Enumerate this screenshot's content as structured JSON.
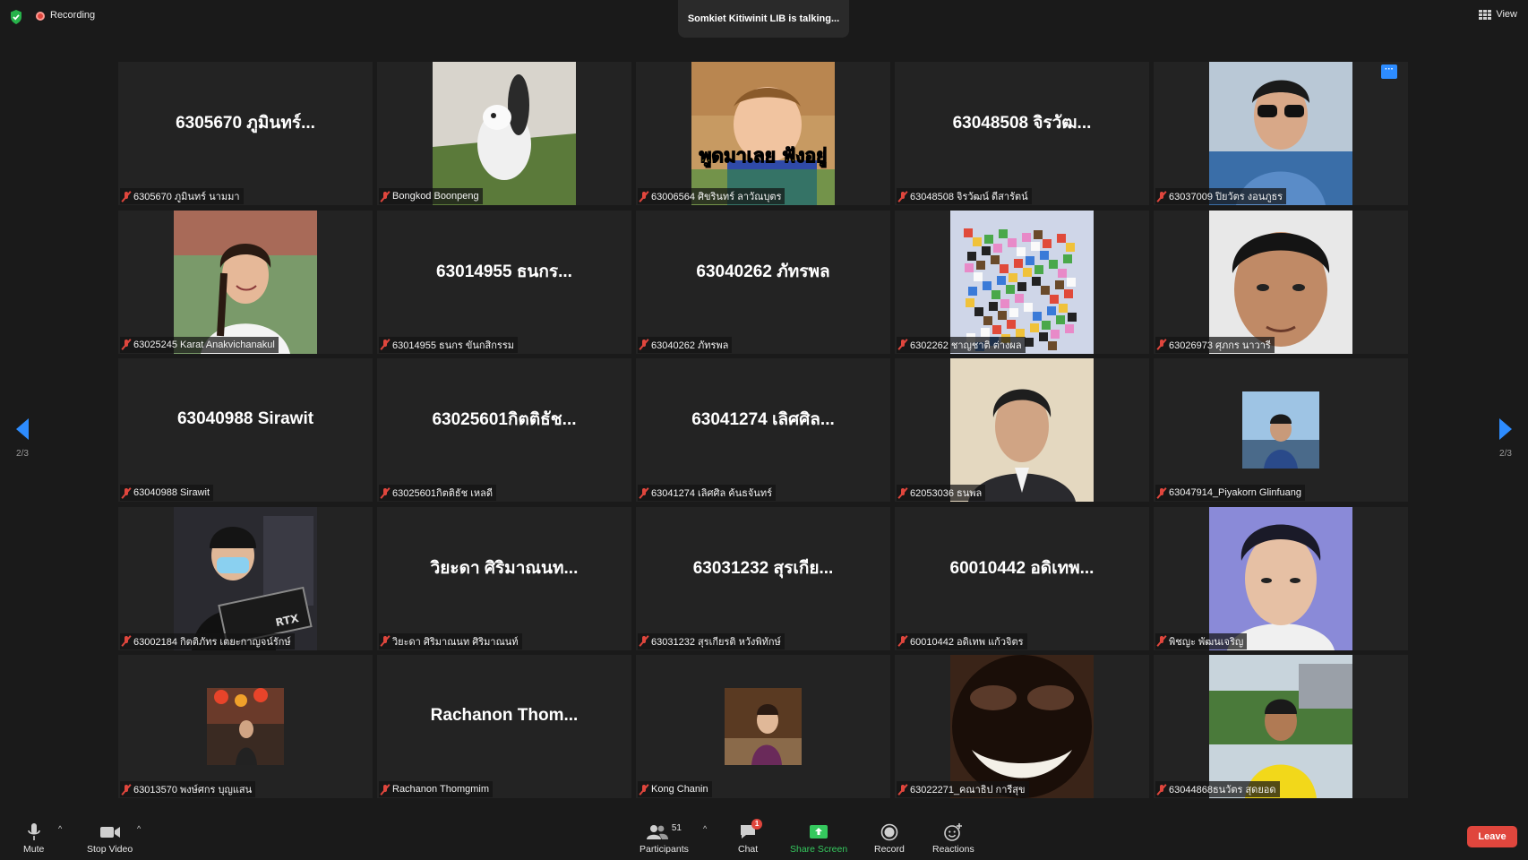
{
  "top_bar": {
    "recording_label": "Recording",
    "talking_text": "Somkiet Kitiwinit LIB is talking...",
    "view_label": "View"
  },
  "pagination": {
    "left": "2/3",
    "right": "2/3"
  },
  "tiles": [
    {
      "big": "6305670 ภูมินทร์...",
      "label": "6305670 ภูมินทร์ นามมา",
      "art": "none"
    },
    {
      "big": "",
      "label": "Bongkod Boonpeng",
      "art": "dog"
    },
    {
      "big": "",
      "label": "63006564 ศิขรินทร์ ลาวัณบุตร",
      "art": "baby"
    },
    {
      "big": "63048508 จิรวัฒ...",
      "label": "63048508 จิรวัฒน์ ดีสารัตน์",
      "art": "none"
    },
    {
      "big": "",
      "label": "63037009 ปิยวัตร งอนภูธร",
      "art": "man-sunglasses",
      "more": "···"
    },
    {
      "big": "",
      "label": "63025245 Karat Anakvichanakul",
      "art": "girl"
    },
    {
      "big": "63014955 ธนกร...",
      "label": "63014955 ธนกร ขันกสิกรรม",
      "art": "none"
    },
    {
      "big": "63040262 ภัทรพล",
      "label": "63040262 ภัทรพล",
      "art": "none"
    },
    {
      "big": "",
      "label": "6302262 ชาญชาติ ต่างผล",
      "art": "mosaic"
    },
    {
      "big": "",
      "label": "63026973 ศุภกร นาวารี",
      "art": "face"
    },
    {
      "big": "63040988 Sirawit",
      "label": "63040988 Sirawit",
      "art": "none"
    },
    {
      "big": "63025601กิตติธัช...",
      "label": "63025601กิตติธัช เหลดี",
      "art": "none"
    },
    {
      "big": "63041274 เลิศศิล...",
      "label": "63041274 เลิศศิล ค้นธจันทร์",
      "art": "none"
    },
    {
      "big": "",
      "label": "62053036 ธนพล",
      "art": "portrait"
    },
    {
      "big": "",
      "label": "63047914_Piyakorn Glinfuang",
      "art": "small-outdoor"
    },
    {
      "big": "",
      "label": "63002184 กิตติภัทร เตยะกาญจน์รักษ์",
      "art": "gpu"
    },
    {
      "big": "วิยะดา ศิริมาณนท...",
      "label": "วิยะดา ศิริมาณนท ศิริมาณนท์",
      "art": "none"
    },
    {
      "big": "63031232 สุรเกีย...",
      "label": "63031232 สุรเกียรติ หวังพิทักษ์",
      "art": "none"
    },
    {
      "big": "60010442 อดิเทพ...",
      "label": "60010442 อดิเทพ แก้วจิตร",
      "art": "none"
    },
    {
      "big": "",
      "label": "พิชญะ พัฒนเจริญ",
      "art": "face2"
    },
    {
      "big": "",
      "label": "63013570 พงษ์ศกร บุญแสน",
      "art": "small-market"
    },
    {
      "big": "Rachanon  Thom...",
      "label": "Rachanon Thomgmim",
      "art": "none"
    },
    {
      "big": "",
      "label": "Kong Chanin",
      "art": "small-boy"
    },
    {
      "big": "",
      "label": "63022271_คณาธิป การีสุข",
      "art": "grin"
    },
    {
      "big": "",
      "label": "63044868ธนวัตร สุดยอด",
      "art": "yellow-shirt"
    }
  ],
  "toolbar": {
    "mute": "Mute",
    "stop_video": "Stop Video",
    "participants": "Participants",
    "participants_count": "51",
    "chat": "Chat",
    "chat_badge": "1",
    "share_screen": "Share Screen",
    "record": "Record",
    "reactions": "Reactions",
    "leave": "Leave"
  },
  "colors": {
    "accent": "#2d8cff",
    "leave": "#e0463d",
    "share": "#35c85e",
    "tile_bg": "#232323",
    "page_bg": "#1a1a1a"
  },
  "baby_caption": "พูดมาเลย ฟังอยู่"
}
